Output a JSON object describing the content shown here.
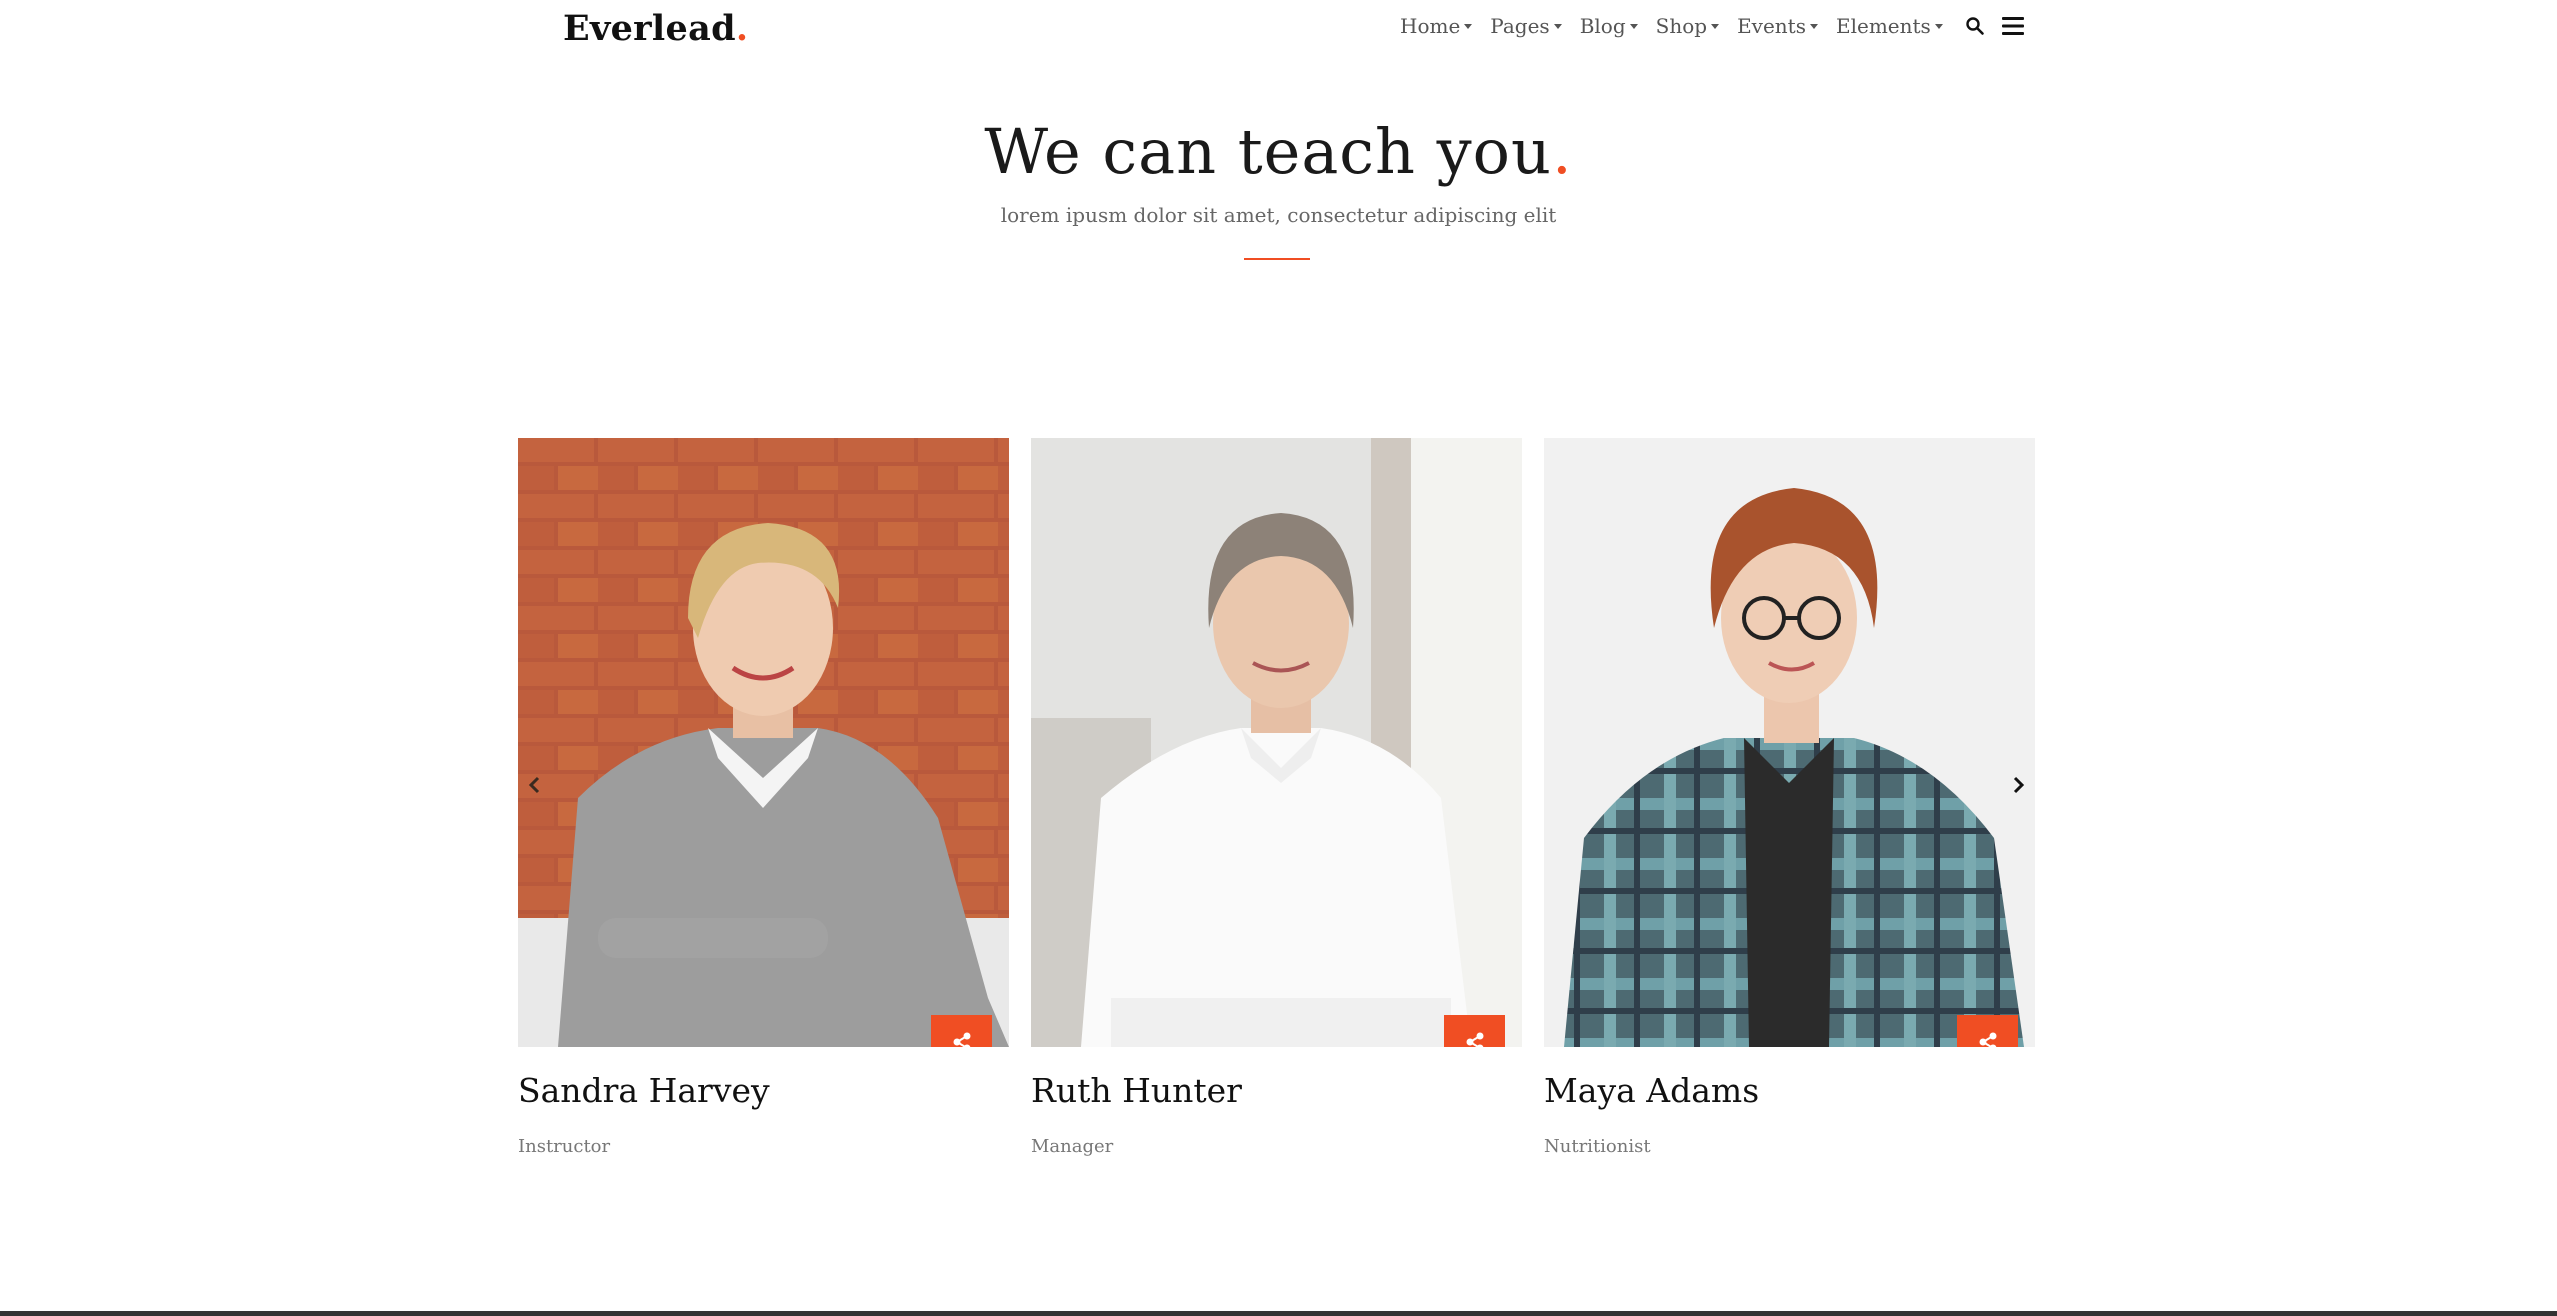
{
  "brand": {
    "name": "Everlead",
    "dot": "."
  },
  "nav": {
    "items": [
      "Home",
      "Pages",
      "Blog",
      "Shop",
      "Events",
      "Elements"
    ],
    "search_icon": "search-icon",
    "menu_icon": "hamburger-menu-icon"
  },
  "hero": {
    "title": "We can teach you",
    "title_dot": ".",
    "subtitle": "lorem ipusm dolor sit amet, consectetur adipiscing elit"
  },
  "team": [
    {
      "name": "Sandra Harvey",
      "role": "Instructor"
    },
    {
      "name": "Ruth Hunter",
      "role": "Manager"
    },
    {
      "name": "Maya Adams",
      "role": "Nutritionist"
    }
  ],
  "carousel": {
    "prev_icon": "chevron-left-icon",
    "next_icon": "chevron-right-icon"
  },
  "colors": {
    "accent": "#f04e23",
    "text": "#222222",
    "muted": "#777777"
  }
}
